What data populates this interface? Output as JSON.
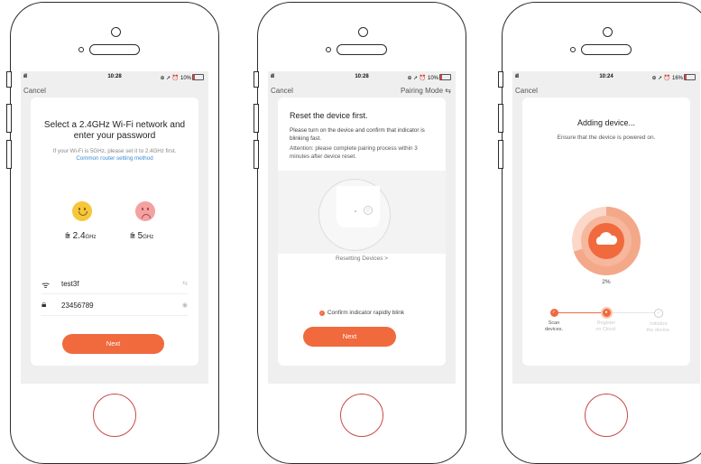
{
  "colors": {
    "accent": "#f06a3d",
    "link": "#3e8bd8",
    "happy": "#f6c73b",
    "sad": "#f4a1a1"
  },
  "screen1": {
    "status": {
      "signal": "ıll",
      "time": "10:28",
      "right": "⊕ ➚ ⏰ 10%"
    },
    "nav": {
      "cancel": "Cancel"
    },
    "title_line1": "Select a 2.4GHz Wi-Fi network and",
    "title_line2": "enter your password",
    "hint": "If your Wi-Fi is 5GHz, please set it to 2.4GHz first.",
    "link": "Common router setting method",
    "band_good": {
      "value": "2.4",
      "unit": "GHz"
    },
    "band_bad": {
      "value": "5",
      "unit": "GHz"
    },
    "ssid": "test3f",
    "password": "23456789",
    "next": "Next"
  },
  "screen2": {
    "status": {
      "signal": "ıll",
      "time": "10:28",
      "right": "⊕ ➚ ⏰ 10%"
    },
    "nav": {
      "cancel": "Cancel",
      "mode": "Pairing Mode ⇆"
    },
    "title": "Reset the device first.",
    "para1": "Please turn on the device and confirm that indicator is blinking fast.",
    "para2": "Attention: please complete pairing process within 3 minutes after device reset.",
    "reset_link": "Resetting Devices >",
    "confirm": "Confirm indicator rapidly blink",
    "next": "Next"
  },
  "screen3": {
    "status": {
      "signal": "ıll",
      "time": "10:24",
      "right": "⊕ ➚ ⏰ 16%"
    },
    "nav": {
      "cancel": "Cancel"
    },
    "title": "Adding device...",
    "subtitle": "Ensure that the device is powered on.",
    "progress": 2,
    "progress_label": "2%",
    "steps": [
      {
        "line1": "Scan",
        "line2": "devices.",
        "state": "done"
      },
      {
        "line1": "Register",
        "line2": "on Cloud.",
        "state": "active"
      },
      {
        "line1": "Initialize",
        "line2": "the device.",
        "state": "todo"
      }
    ]
  }
}
